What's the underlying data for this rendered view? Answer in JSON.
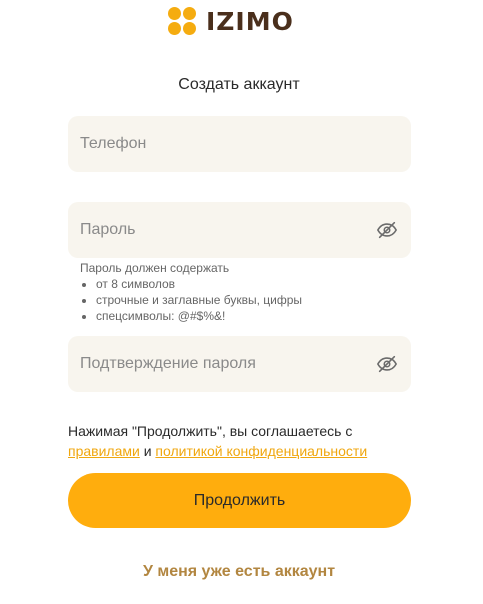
{
  "brand": {
    "name": "IZIMO",
    "accent_color": "#ffad0d",
    "logo_color": "#4a2f1c"
  },
  "form": {
    "title": "Создать аккаунт",
    "phone_placeholder": "Телефон",
    "password_placeholder": "Пароль",
    "confirm_placeholder": "Подтверждение пароля",
    "password_icon": "eye-off-icon",
    "password_hint": {
      "heading": "Пароль должен содержать",
      "rules": [
        "от 8 символов",
        "строчные и заглавные буквы, цифры",
        "спецсимволы: @#$%&!"
      ]
    },
    "consent": {
      "text_before": "Нажимая \"Продолжить\", вы соглашаетесь с ",
      "rules_link": "правилами",
      "conjunction": " и ",
      "privacy_link": "политикой конфиденциальности"
    },
    "continue_label": "Продолжить",
    "have_account_label": "У меня уже есть аккаунт"
  }
}
